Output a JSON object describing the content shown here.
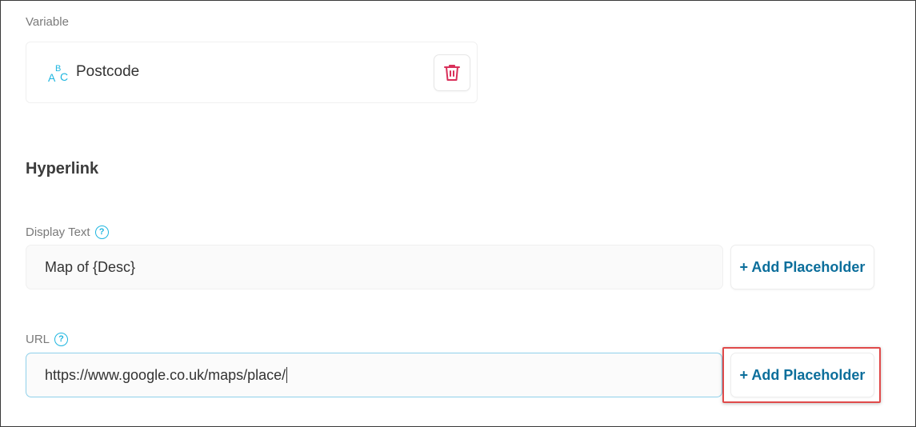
{
  "variable_section": {
    "label": "Variable",
    "variable_name": "Postcode",
    "type_icon": "abc-text-icon",
    "delete_icon": "trash-icon"
  },
  "hyperlink_section": {
    "title": "Hyperlink",
    "display_text": {
      "label": "Display Text",
      "value": "Map of {Desc}",
      "add_placeholder_label": "+ Add Placeholder"
    },
    "url": {
      "label": "URL",
      "value": "https://www.google.co.uk/maps/place/",
      "add_placeholder_label": "+ Add Placeholder"
    }
  },
  "colors": {
    "accent_text": "#0b6e9b",
    "help_icon": "#1fb6e0",
    "delete_icon": "#d9305a",
    "highlight_box": "#e04a4a"
  }
}
